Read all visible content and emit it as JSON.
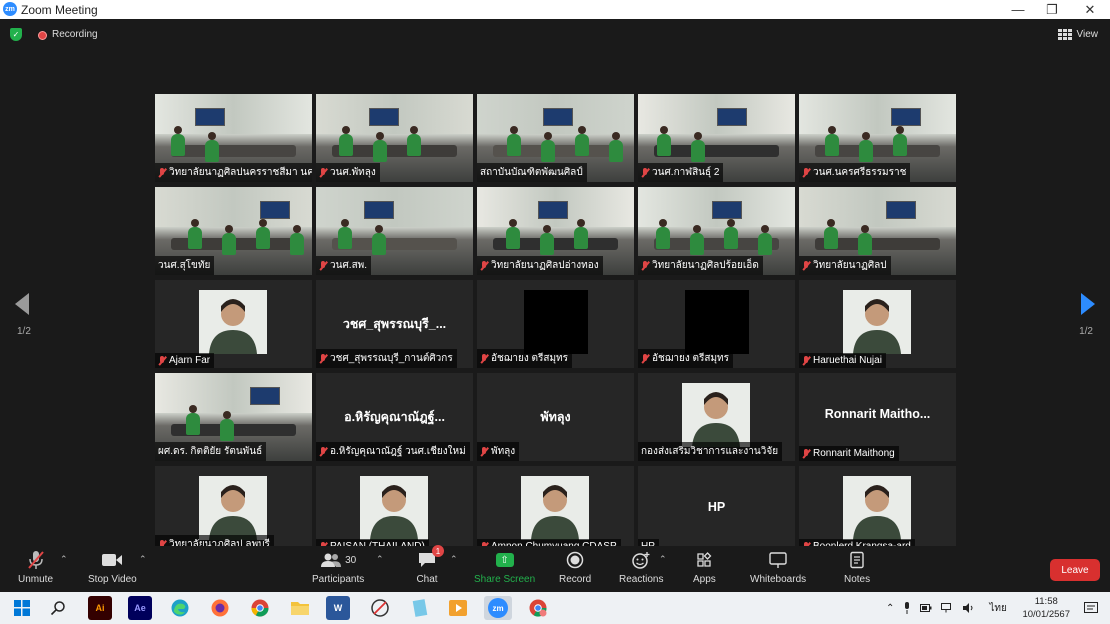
{
  "window": {
    "app_icon": "zm",
    "title": "Zoom Meeting",
    "controls": [
      "minimize-icon",
      "restore-icon",
      "close-icon"
    ]
  },
  "meeting": {
    "security_icon": "shield-check-icon",
    "recording_label": "Recording",
    "view_label": "View",
    "page_left": "1/2",
    "page_right": "1/2"
  },
  "tiles": [
    {
      "name": "วิทยาลัยนาฏศิลปนครราชสีมา นครา...",
      "type": "video",
      "muted": true
    },
    {
      "name": "วนศ.พัทลุง",
      "type": "video",
      "muted": true
    },
    {
      "name": "สถาบันบัณฑิตพัฒนศิลป์",
      "type": "video",
      "muted": false,
      "active": true
    },
    {
      "name": "วนศ.กาฬสินธุ์ 2",
      "type": "video",
      "muted": true
    },
    {
      "name": "วนศ.นครศรีธรรมราช",
      "type": "video",
      "muted": true
    },
    {
      "name": "วนศ.สุโขทัย",
      "type": "video",
      "muted": false
    },
    {
      "name": "วนศ.สพ.",
      "type": "video",
      "muted": true
    },
    {
      "name": "วิทยาลัยนาฏศิลปอ่างทอง",
      "type": "video",
      "muted": true
    },
    {
      "name": "วิทยาลัยนาฏศิลปร้อยเอ็ด",
      "type": "video",
      "muted": true
    },
    {
      "name": "วิทยาลัยนาฏศิลป",
      "type": "video",
      "muted": true
    },
    {
      "name": "Ajarn Far",
      "type": "photo",
      "muted": true
    },
    {
      "name": "วชศ_สุพรรณบุรี_กานต์ศิวกร",
      "center": "วชศ_สุพรรณบุรี_...",
      "type": "text",
      "muted": true
    },
    {
      "name": "อัชฌายง ตรีสมุทร",
      "type": "black",
      "muted": true
    },
    {
      "name": "อัชฌายง ตรีสมุทร",
      "type": "black",
      "muted": true
    },
    {
      "name": "Haruethai Nujai",
      "type": "photo",
      "muted": true
    },
    {
      "name": "ผศ.ดร. กิตติยัย รัตนพันธ์",
      "type": "video",
      "muted": false
    },
    {
      "name": "อ.หิรัญคุณาณัฎฐ์ วนศ.เชียงใหม่",
      "center": "อ.หิรัญคุณาณัฎฐ์...",
      "type": "text",
      "muted": true
    },
    {
      "name": "พัทลุง",
      "center": "พัทลุง",
      "type": "text",
      "muted": true
    },
    {
      "name": "กองส่งเสริมวิชาการและงานวิจัย",
      "type": "photo",
      "muted": false
    },
    {
      "name": "Ronnarit Maithong",
      "center": "Ronnarit  Maitho...",
      "type": "text",
      "muted": true
    },
    {
      "name": "วิทยาลัยนาฏศิลป ลพบุรี",
      "type": "photo",
      "muted": true
    },
    {
      "name": "PAISAN (THAILAND)",
      "type": "photo",
      "muted": true
    },
    {
      "name": "Ampon Chumyuang CDASP",
      "type": "photo",
      "muted": true
    },
    {
      "name": "HP",
      "center": "HP",
      "type": "text",
      "muted": false
    },
    {
      "name": "Boonlerd Krangsa-ard",
      "type": "photo",
      "muted": true
    }
  ],
  "toolbar": {
    "unmute": "Unmute",
    "stop_video": "Stop Video",
    "participants": "Participants",
    "participants_count": "30",
    "chat": "Chat",
    "chat_badge": "1",
    "share_screen": "Share Screen",
    "record": "Record",
    "reactions": "Reactions",
    "apps": "Apps",
    "whiteboards": "Whiteboards",
    "notes": "Notes",
    "leave": "Leave"
  },
  "taskbar": {
    "apps": [
      "windows-start-icon",
      "search-icon",
      "illustrator-icon",
      "after-effects-icon",
      "edge-icon",
      "firefox-icon",
      "chrome-icon",
      "file-explorer-icon",
      "word-icon",
      "app-icon",
      "notepad-icon",
      "media-player-icon",
      "zoom-icon",
      "chrome-alt-icon"
    ],
    "language": "ไทย",
    "time": "11:58",
    "date": "10/01/2567"
  },
  "colors": {
    "zoom_blue": "#2D8CFF",
    "active_speaker": "#c8e64b",
    "leave_red": "#d8302f",
    "share_green": "#22b14c"
  }
}
